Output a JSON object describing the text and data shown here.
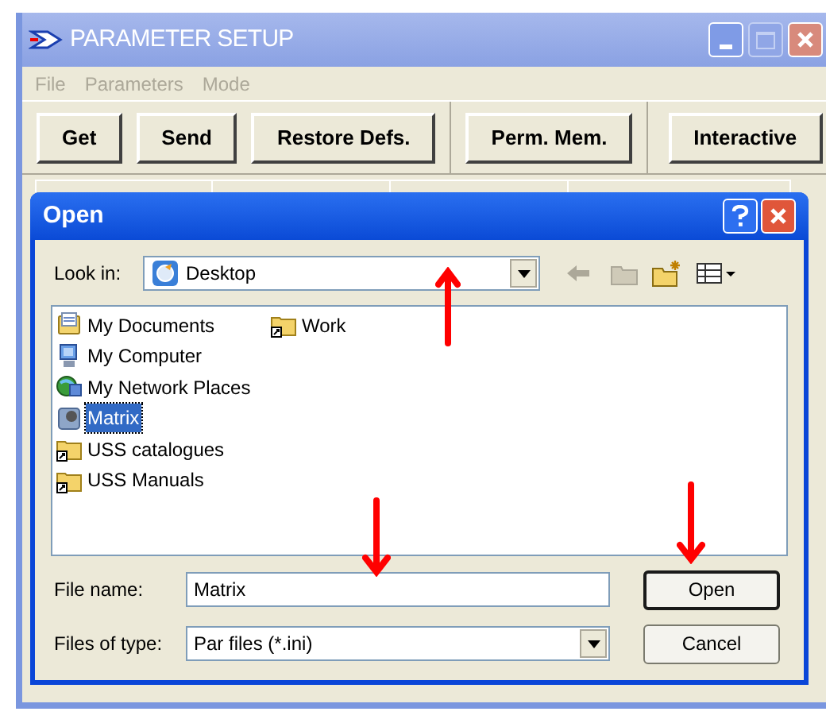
{
  "window": {
    "title": "PARAMETER SETUP"
  },
  "menu": [
    "File",
    "Parameters",
    "Mode"
  ],
  "toolbar": [
    {
      "buttons": [
        "Get",
        "Send",
        "Restore Defs."
      ]
    },
    {
      "buttons": [
        "Perm. Mem."
      ]
    },
    {
      "buttons": [
        "Interactive"
      ]
    }
  ],
  "dialog": {
    "title": "Open",
    "look_in": {
      "label": "Look in:",
      "value": "Desktop"
    },
    "items": [
      {
        "label": "My Documents",
        "kind": "documents",
        "selected": false
      },
      {
        "label": "My Computer",
        "kind": "computer",
        "selected": false
      },
      {
        "label": "My Network Places",
        "kind": "network",
        "selected": false
      },
      {
        "label": "Matrix",
        "kind": "file",
        "selected": true
      },
      {
        "label": "USS catalogues",
        "kind": "folder-shortcut",
        "selected": false
      },
      {
        "label": "USS Manuals",
        "kind": "folder-shortcut",
        "selected": false
      },
      {
        "label": "Work",
        "kind": "folder-shortcut",
        "selected": false
      }
    ],
    "file_name": {
      "label": "File name:",
      "value": "Matrix"
    },
    "file_type": {
      "label": "Files of type:",
      "value": "Par files (*.ini)"
    },
    "buttons": [
      {
        "label": "Open",
        "default": true
      },
      {
        "label": "Cancel",
        "default": false
      }
    ]
  }
}
